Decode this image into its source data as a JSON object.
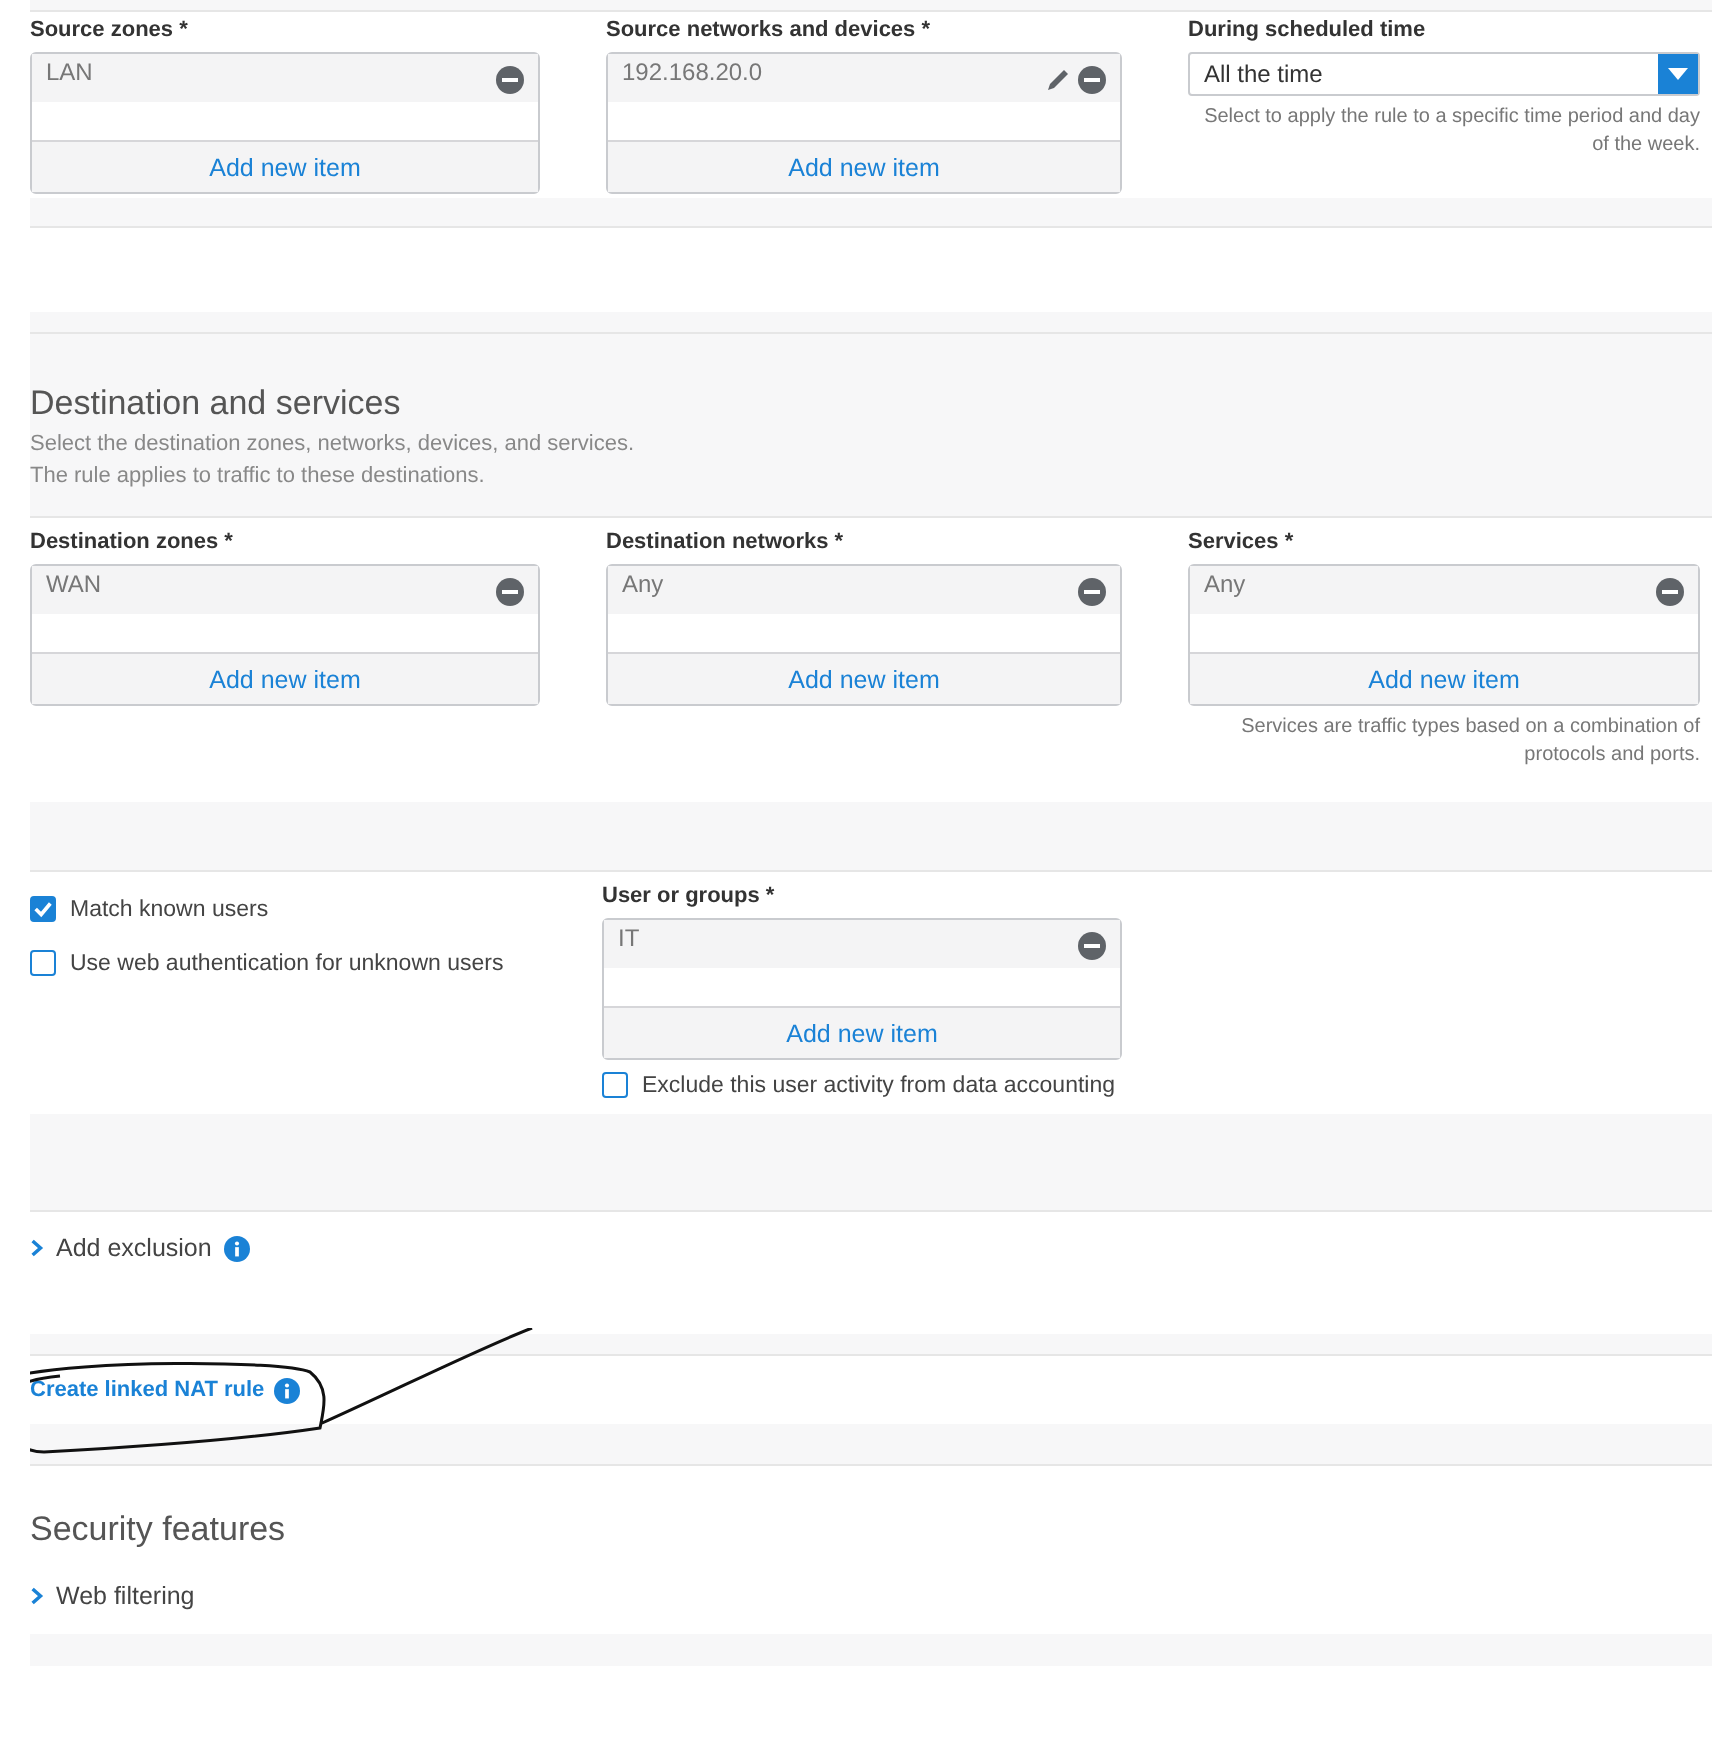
{
  "source": {
    "fields": [
      {
        "label": "Source zones *",
        "items": [
          {
            "text": "LAN",
            "editable": false
          }
        ],
        "add_label": "Add new item"
      },
      {
        "label": "Source networks and devices *",
        "items": [
          {
            "text": "192.168.20.0",
            "editable": true
          }
        ],
        "add_label": "Add new item"
      }
    ],
    "schedule": {
      "label": "During scheduled time",
      "value": "All the time",
      "hint": "Select to apply the rule to a specific time period and day of the week."
    }
  },
  "destination": {
    "title": "Destination and services",
    "description": [
      "Select the destination zones, networks, devices, and services.",
      "The rule applies to traffic to these destinations."
    ],
    "fields": [
      {
        "label": "Destination zones *",
        "items": [
          {
            "text": "WAN",
            "editable": false
          }
        ],
        "add_label": "Add new item"
      },
      {
        "label": "Destination networks *",
        "items": [
          {
            "text": "Any",
            "editable": false
          }
        ],
        "add_label": "Add new item"
      },
      {
        "label": "Services *",
        "items": [
          {
            "text": "Any",
            "editable": false
          }
        ],
        "add_label": "Add new item",
        "hint": "Services are traffic types based on a combination of protocols and ports."
      }
    ]
  },
  "users": {
    "options": [
      {
        "label": "Match known users",
        "checked": true
      },
      {
        "label": "Use web authentication for unknown users",
        "checked": false
      }
    ],
    "groups_field": {
      "label": "User or groups *",
      "items": [
        {
          "text": "IT",
          "editable": false
        }
      ],
      "add_label": "Add new item"
    },
    "exclude": {
      "label": "Exclude this user activity from data accounting",
      "checked": false
    }
  },
  "exclusion": {
    "label": "Add exclusion",
    "expanded": false
  },
  "nat": {
    "label": "Create linked NAT rule"
  },
  "security": {
    "title": "Security features",
    "items": [
      {
        "label": "Web filtering",
        "expanded": false
      }
    ]
  }
}
